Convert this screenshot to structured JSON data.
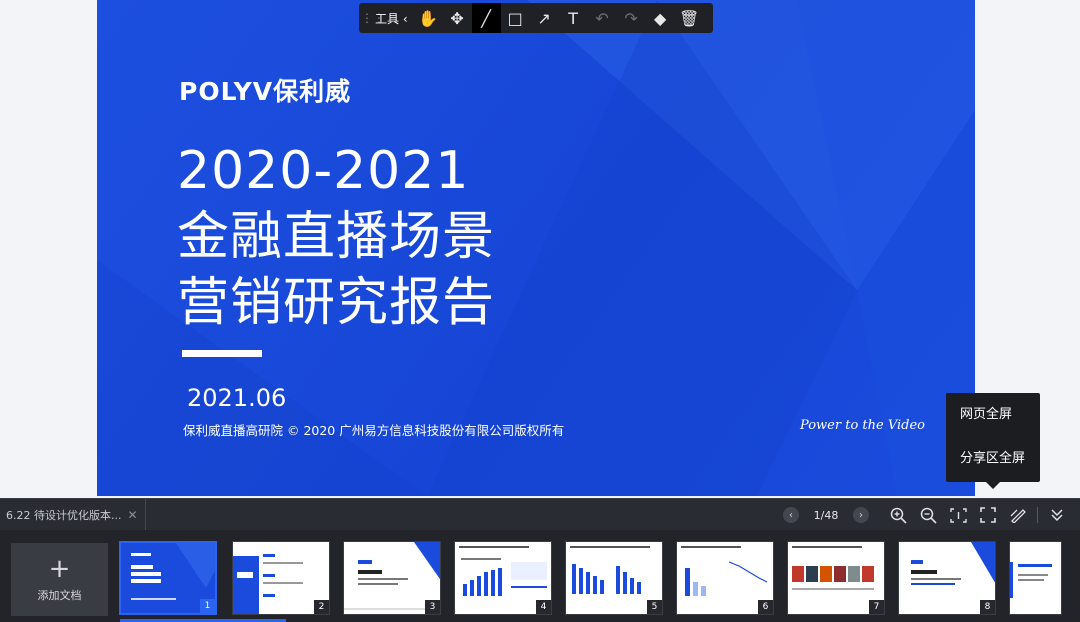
{
  "toolbar": {
    "grip": "⋮⋮",
    "label": "工具 ‹",
    "tools": [
      {
        "name": "hand-icon",
        "glyph": "✋",
        "active": false,
        "disabled": false
      },
      {
        "name": "move-icon",
        "glyph": "✥",
        "active": false,
        "disabled": false
      },
      {
        "name": "pen-icon",
        "glyph": "╱",
        "active": true,
        "disabled": false
      },
      {
        "name": "rectangle-icon",
        "glyph": "□",
        "active": false,
        "disabled": false
      },
      {
        "name": "arrow-icon",
        "glyph": "↗",
        "active": false,
        "disabled": false
      },
      {
        "name": "text-icon",
        "glyph": "T",
        "active": false,
        "disabled": false
      },
      {
        "name": "undo-icon",
        "glyph": "↶",
        "active": false,
        "disabled": true
      },
      {
        "name": "redo-icon",
        "glyph": "↷",
        "active": false,
        "disabled": true
      },
      {
        "name": "eraser-icon",
        "glyph": "◆",
        "active": false,
        "disabled": false
      },
      {
        "name": "trash-icon",
        "glyph": "🗑",
        "active": false,
        "disabled": false
      }
    ]
  },
  "slide": {
    "logo": "POLYV保利威",
    "title_line1": "2020-2021",
    "title_line2": "金融直播场景",
    "title_line3": "营销研究报告",
    "date": "2021.06",
    "copyright": "保利威直播高研院 © 2020 广州易方信息科技股份有限公司版权所有",
    "tagline": "Power to the Video",
    "bg_color": "#1a4bdc"
  },
  "fullscreen_menu": {
    "item1": "网页全屏",
    "item2": "分享区全屏"
  },
  "controlbar": {
    "doc_name": "6.22 待设计优化版本...",
    "close": "✕",
    "prev": "‹",
    "next": "›",
    "page_indicator": "1/48"
  },
  "strip": {
    "add_doc_plus": "+",
    "add_doc_label": "添加文档",
    "thumbs": [
      "1",
      "2",
      "3",
      "4",
      "5",
      "6",
      "7",
      "8"
    ]
  }
}
